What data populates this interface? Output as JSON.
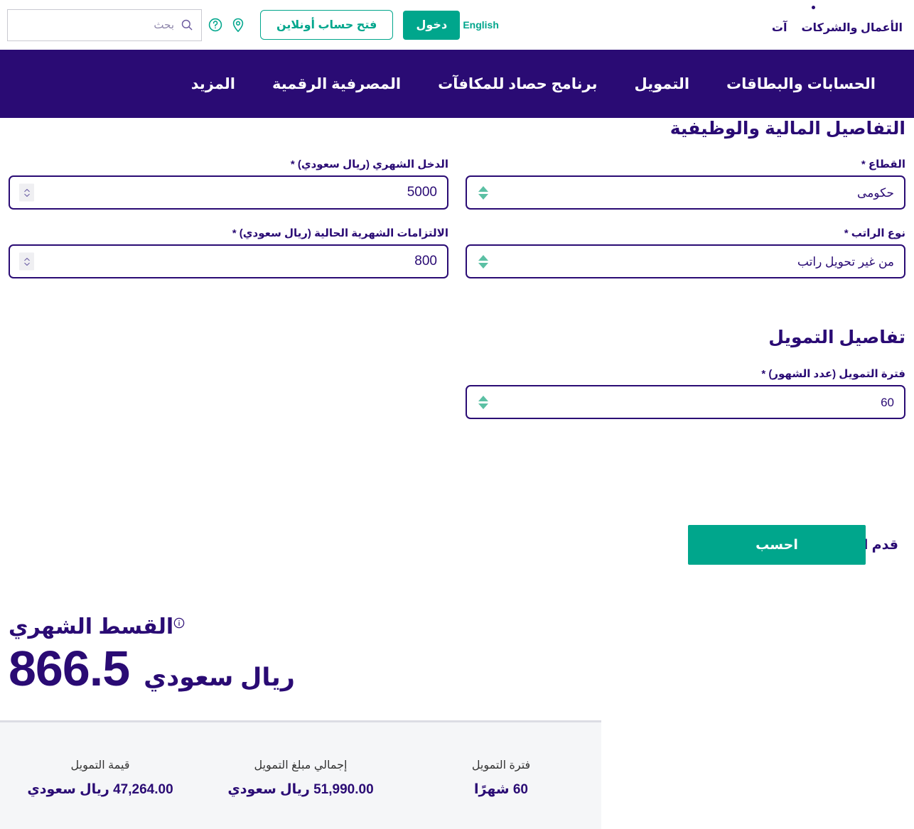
{
  "topbar": {
    "corp_links": [
      {
        "label": "الأعمال والشركات"
      },
      {
        "label": "آت"
      }
    ],
    "language_switch": "English",
    "login_label": "دخول",
    "open_account_label": "فتح حساب أونلاين",
    "location_icon": "location-pin-icon",
    "help_icon": "question-circle-icon",
    "search": {
      "placeholder": "بحث",
      "value": "",
      "icon": "search-icon"
    }
  },
  "mainnav": {
    "items": [
      {
        "label": "الحسابات والبطاقات"
      },
      {
        "label": "التمويل"
      },
      {
        "label": "برنامج حصاد للمكافآت"
      },
      {
        "label": "المصرفية الرقمية"
      },
      {
        "label": "المزيد"
      }
    ]
  },
  "financial_section": {
    "title": "التفاصيل المالية والوظيفية",
    "sector": {
      "label": "القطاع *",
      "value": "حكومى",
      "options": [
        "حكومى"
      ]
    },
    "monthly_income": {
      "label": "الدخل الشهري (ريال سعودي) *",
      "value": "5000"
    },
    "salary_type": {
      "label": "نوع الراتب *",
      "value": "من غير تحويل راتب",
      "options": [
        "من غير تحويل راتب"
      ]
    },
    "current_obligations": {
      "label": "الالتزامات الشهرية الحالية (ريال سعودي) *",
      "value": "800"
    }
  },
  "financing_section": {
    "title": "تفاصيل التمويل",
    "tenure": {
      "label": "فترة التمويل (عدد الشهور) *",
      "value": "60",
      "options": [
        "60"
      ]
    }
  },
  "actions": {
    "calculate_label": "احسب",
    "apply_label": "قدم الآن"
  },
  "result": {
    "title": "القسط الشهري",
    "info_icon": "info-circle-icon",
    "amount": "866.5",
    "currency": "ريال سعودي"
  },
  "summary": {
    "cells": [
      {
        "label": "فترة التمويل",
        "value": "60 شهرًا"
      },
      {
        "label": "إجمالي مبلغ التمويل",
        "value": "51,990.00 ريال سعودي"
      },
      {
        "label": "قيمة التمويل",
        "value": "47,264.00 ريال سعودي"
      }
    ]
  },
  "colors": {
    "brand_purple": "#2A0B74",
    "brand_teal": "#00A68C",
    "select_arrow": "#5BC0A4",
    "panel_bg": "#F5F6F8"
  }
}
